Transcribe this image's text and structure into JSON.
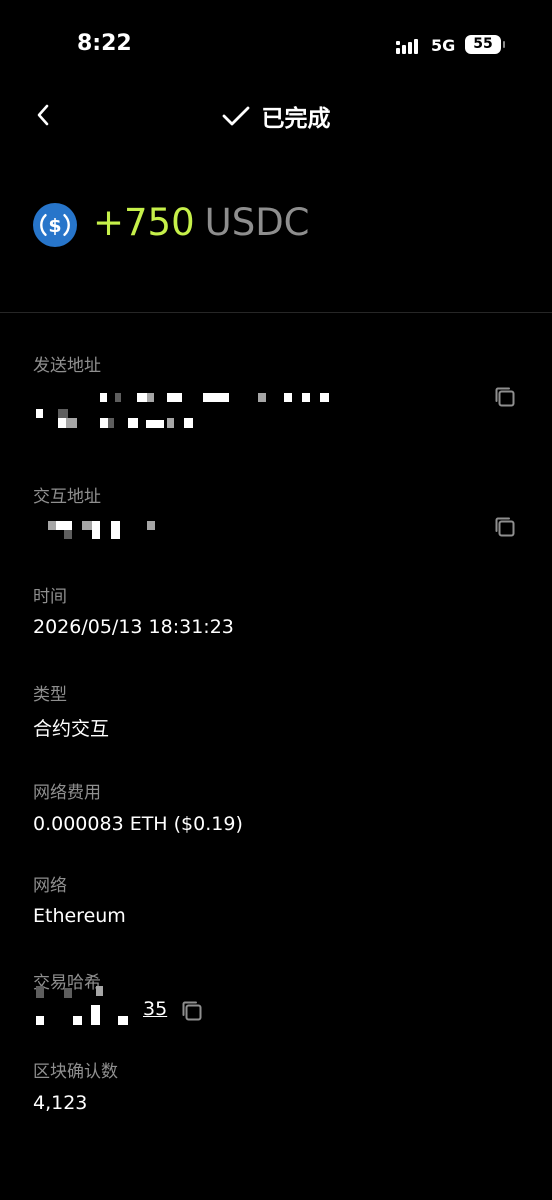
{
  "status": {
    "time": "8:22",
    "network": "5G",
    "battery": "55"
  },
  "header": {
    "title": "已完成",
    "back_icon": "chevron-left-icon",
    "status_icon": "check-icon"
  },
  "transfer": {
    "amount": "+750",
    "symbol": "USDC",
    "token_icon": "usdc-coin-icon",
    "amount_color": "#c6f04a"
  },
  "details": {
    "sender_label": "发送地址",
    "counterparty_label": "交互地址",
    "time_label": "时间",
    "time_value": "2026/05/13 18:31:23",
    "type_label": "类型",
    "type_value": "合约交互",
    "fee_label": "网络费用",
    "fee_value": "0.000083 ETH ($0.19)",
    "network_label": "网络",
    "network_value": "Ethereum",
    "hash_label": "交易哈希",
    "hash_tail": "35",
    "confirmations_label": "区块确认数",
    "confirmations_value": "4,123",
    "copy_icon": "copy-icon"
  }
}
